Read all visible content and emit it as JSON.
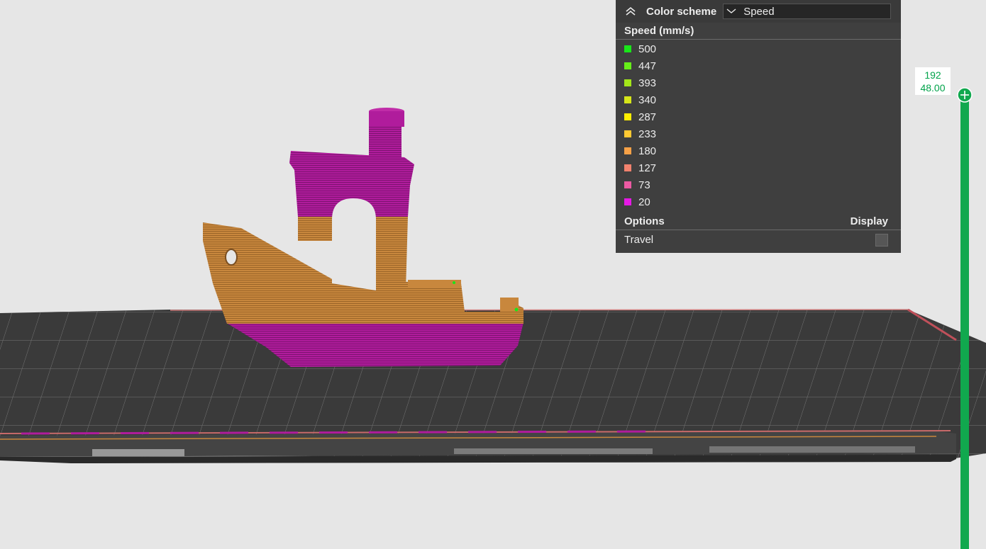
{
  "legend": {
    "color_scheme_label": "Color scheme",
    "selected_scheme": "Speed",
    "section_title": "Speed (mm/s)",
    "items": [
      {
        "label": "500",
        "color": "#19e619"
      },
      {
        "label": "447",
        "color": "#66ee19"
      },
      {
        "label": "393",
        "color": "#a3e619"
      },
      {
        "label": "340",
        "color": "#d6e619"
      },
      {
        "label": "287",
        "color": "#ffee00"
      },
      {
        "label": "233",
        "color": "#ffc933"
      },
      {
        "label": "180",
        "color": "#f7a147"
      },
      {
        "label": "127",
        "color": "#f2826e"
      },
      {
        "label": "73",
        "color": "#ec5aa3"
      },
      {
        "label": "20",
        "color": "#e619e6"
      }
    ],
    "options_label": "Options",
    "display_label": "Display",
    "travel_label": "Travel"
  },
  "layer_slider": {
    "layer": "192",
    "height": "48.00",
    "color": "#11a84e"
  },
  "colors": {
    "model_body": "#c8873d",
    "model_pink": "#b01c9c",
    "bed": "#3a3a3a",
    "background": "#e6e6e6"
  }
}
